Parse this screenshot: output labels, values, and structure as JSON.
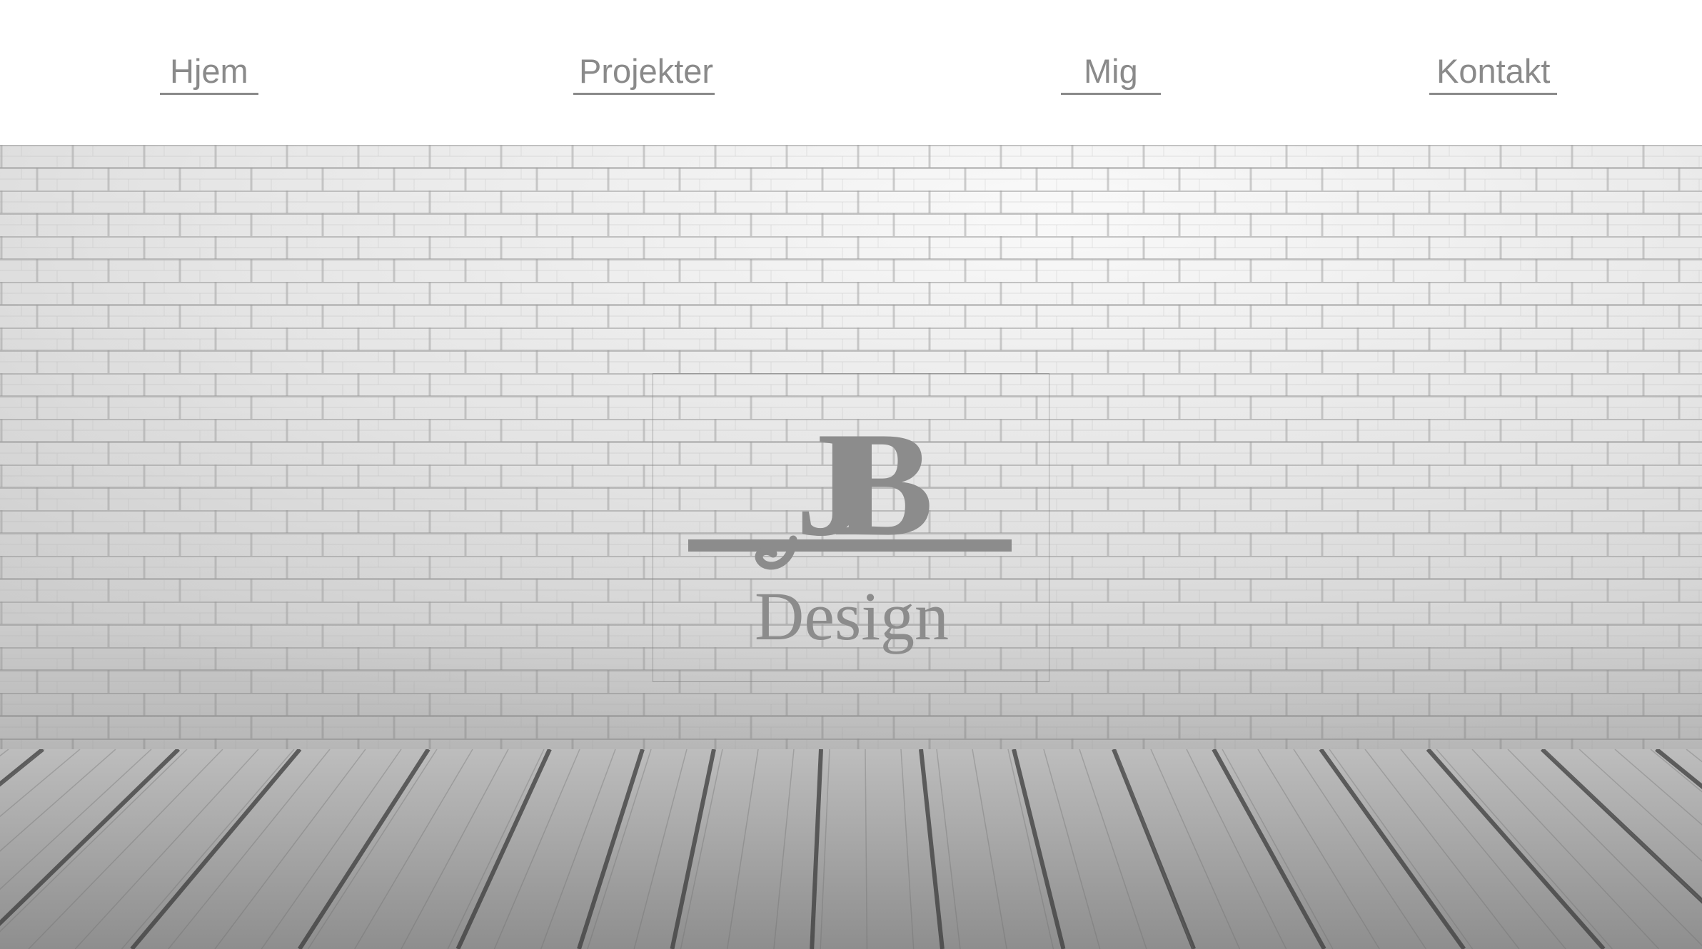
{
  "nav": {
    "items": [
      {
        "label": "Hjem"
      },
      {
        "label": "Projekter"
      },
      {
        "label": "Mig"
      },
      {
        "label": "Kontakt"
      }
    ]
  },
  "hero": {
    "logo": {
      "monogram": "JB",
      "wordmark": "Design"
    }
  },
  "colors": {
    "nav_text": "#8a8a8a",
    "logo": "#8c8c8c",
    "background": "#ffffff"
  }
}
